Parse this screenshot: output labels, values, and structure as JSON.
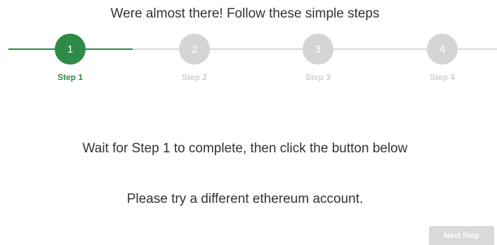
{
  "header": {
    "title": "Were almost there! Follow these simple steps"
  },
  "stepper": {
    "current_step": 1,
    "steps": [
      {
        "number": "1",
        "label": "Step 1",
        "state": "active"
      },
      {
        "number": "2",
        "label": "Step 2",
        "state": "pending"
      },
      {
        "number": "3",
        "label": "Step 3",
        "state": "pending"
      },
      {
        "number": "4",
        "label": "Step 4",
        "state": "pending"
      }
    ]
  },
  "main": {
    "instruction": "Wait for Step 1 to complete, then click the button below",
    "error_message": "Please try a different ethereum account."
  },
  "footer": {
    "next_label": "Next Step",
    "next_disabled": true
  },
  "colors": {
    "accent": "#2e8b47",
    "inactive": "#d5d5d5",
    "text": "#333333"
  }
}
